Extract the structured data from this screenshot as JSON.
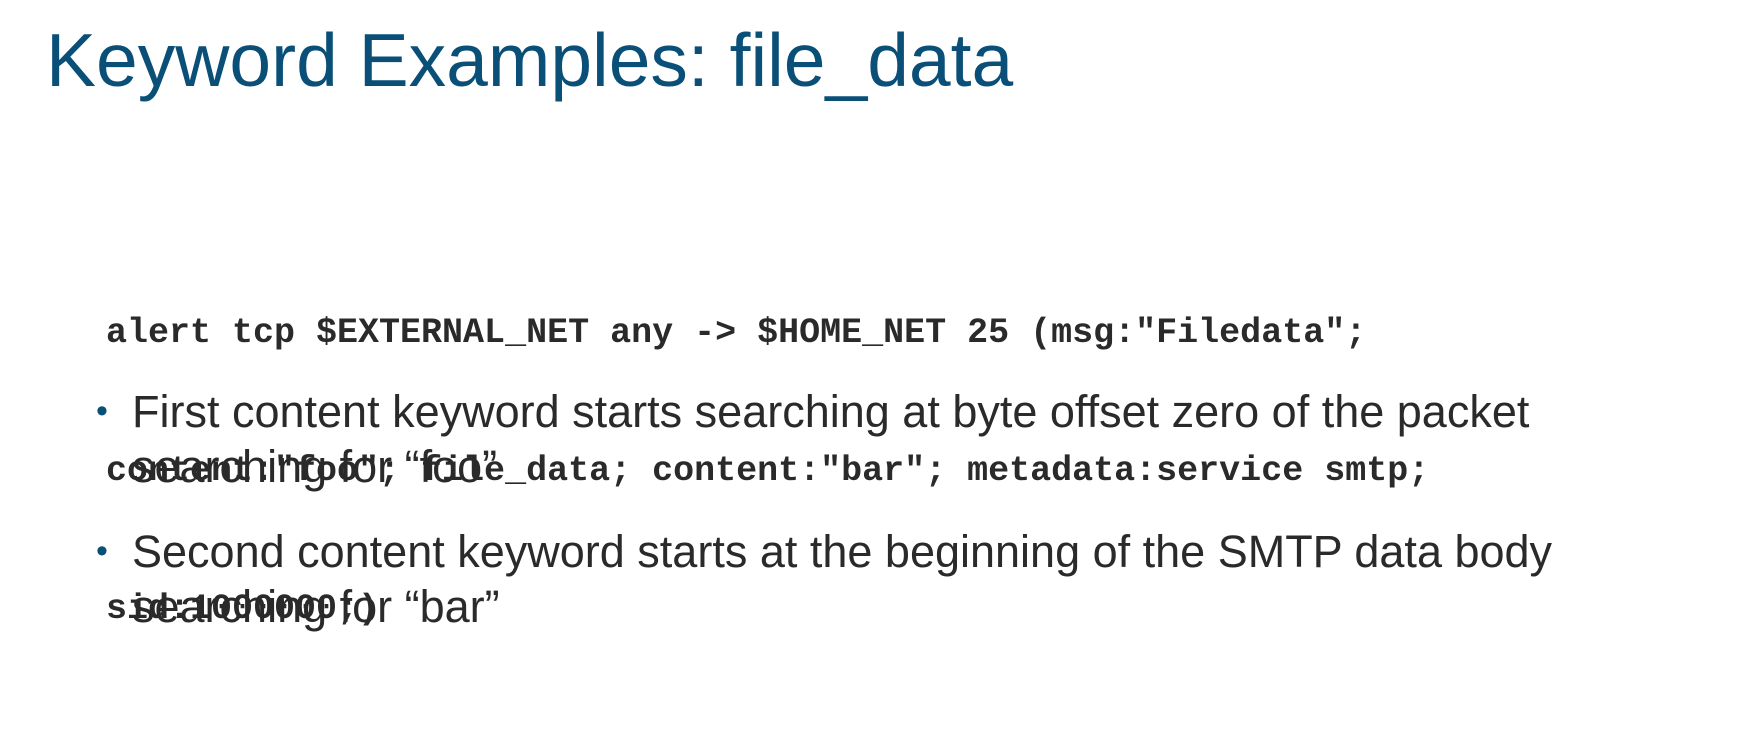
{
  "slide": {
    "title": "Keyword Examples: file_data",
    "code_lines": [
      "alert tcp $EXTERNAL_NET any -> $HOME_NET 25 (msg:″Filedata″;",
      "content:″foo″; file_data; content:″bar″; metadata:service smtp;",
      "sid:1000000;)"
    ],
    "bullets": [
      {
        "marker": "•",
        "line1": "First content keyword starts searching at byte offset zero of the packet",
        "line2": "searching for “foo”"
      },
      {
        "marker": "•",
        "line1": "Second content keyword starts at the beginning of the SMTP data body",
        "line2": "searching for “bar”"
      }
    ],
    "colors": {
      "title": "#0a4f78",
      "text": "#2a2a2a",
      "background": "#ffffff"
    }
  }
}
